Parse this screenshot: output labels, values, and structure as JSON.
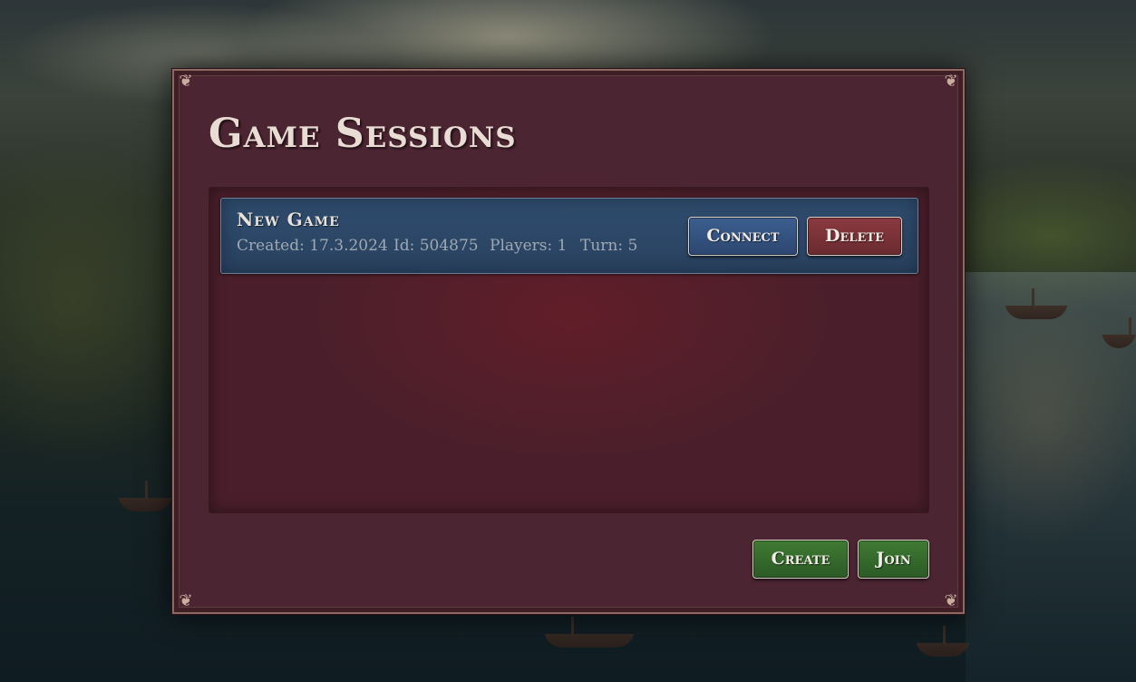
{
  "dialog": {
    "title": "Game Sessions",
    "corner_glyph": "❦"
  },
  "sessions": [
    {
      "name": "New Game",
      "created": "Created: 17.3.2024",
      "id": "Id: 504875",
      "players": "Players: 1",
      "turn": "Turn: 5",
      "connect_label": "Connect",
      "delete_label": "Delete"
    }
  ],
  "footer": {
    "create_label": "Create",
    "join_label": "Join"
  },
  "colors": {
    "panel": "#4c2532",
    "session_row": "#2f4c6e",
    "connect_button": "#3c5f8f",
    "delete_button": "#8a3a40",
    "footer_buttons": "#3f7a34"
  }
}
